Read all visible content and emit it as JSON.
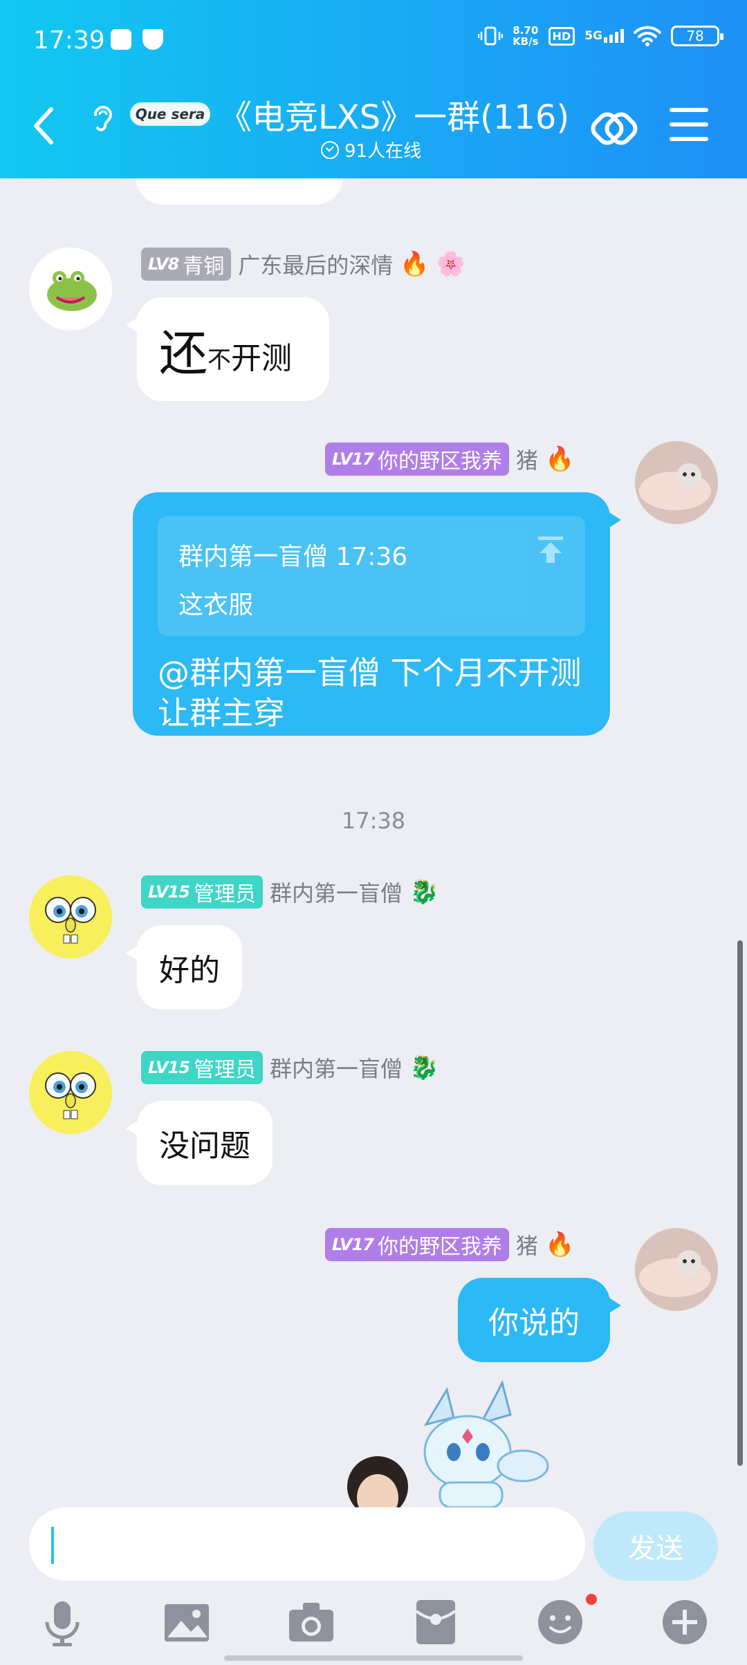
{
  "status_bar": {
    "time": "17:39",
    "net_speed_value": "8.70",
    "net_speed_unit": "KB/s",
    "hd": "HD",
    "signal": "5G",
    "battery": "78"
  },
  "header": {
    "title": "《电竞LXS》一群(116)",
    "online": "91人在线",
    "group_logo_text": "Que sera"
  },
  "messages": [
    {
      "level": "LV8",
      "title": "青铜",
      "name": "广东最后的深情",
      "text_big": "还",
      "text_small": "不",
      "text_rest": "开测"
    },
    {
      "level": "LV17",
      "title": "你的野区我养",
      "name": "猪",
      "quote_meta": "群内第一盲僧 17:36",
      "quote_text": "这衣服",
      "text": "@群内第一盲僧 下个月不开测让群主穿"
    },
    {
      "level": "LV15",
      "title": "管理员",
      "name": "群内第一盲僧",
      "text": "好的"
    },
    {
      "level": "LV15",
      "title": "管理员",
      "name": "群内第一盲僧",
      "text": "没问题"
    },
    {
      "level": "LV17",
      "title": "你的野区我养",
      "name": "猪",
      "text": "你说的"
    }
  ],
  "timestamp": "17:38",
  "input": {
    "placeholder": "",
    "send_label": "发送"
  },
  "colors": {
    "header_start": "#12c8f0",
    "header_end": "#1e90f7",
    "bubble_out": "#2db9f5",
    "badge_gray": "#a9aab5",
    "badge_purple": "#b07ee8",
    "badge_teal": "#3dd6c7"
  },
  "icons": [
    "back-icon",
    "ear-icon",
    "link-icon",
    "menu-icon",
    "mic-icon",
    "image-icon",
    "camera-icon",
    "red-packet-icon",
    "emoji-icon",
    "plus-icon"
  ]
}
